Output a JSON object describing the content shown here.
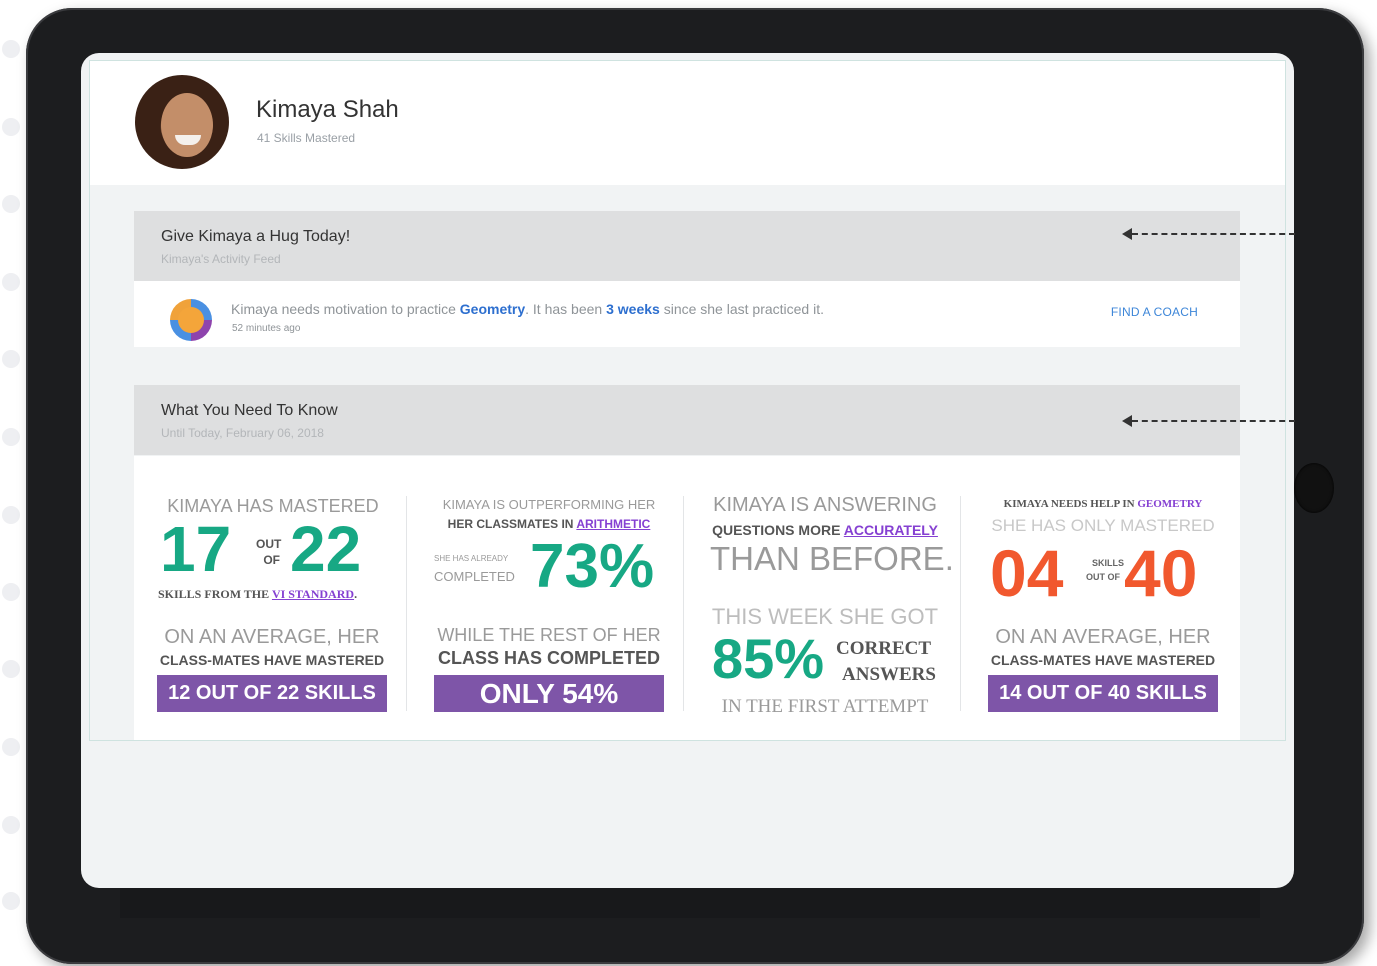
{
  "profile": {
    "name": "Kimaya Shah",
    "skills_mastered": "41 Skills Mastered"
  },
  "hug_section": {
    "title": "Give Kimaya a Hug Today!",
    "subtitle": "Kimaya's Activity Feed"
  },
  "feed": {
    "text_before": "Kimaya needs motivation to practice ",
    "subject": "Geometry",
    "text_middle": ". It has been ",
    "duration": "3 weeks",
    "text_after": " since she last practiced it.",
    "time": "52 minutes ago",
    "action": "FIND A COACH"
  },
  "know_section": {
    "title": "What You Need To Know",
    "subtitle": "Until Today, February 06, 2018"
  },
  "stat1": {
    "heading": "KIMAYA HAS MASTERED",
    "value": "17",
    "out_of_1": "OUT",
    "out_of_2": "OF",
    "total": "22",
    "caption": "SKILLS FROM THE",
    "link": "VI STANDARD",
    "caption_end": ".",
    "avg1": "ON AN AVERAGE, HER",
    "avg2": "CLASS-MATES HAVE MASTERED",
    "bar": "12 OUT OF 22 SKILLS"
  },
  "stat2": {
    "heading1": "KIMAYA IS OUTPERFORMING HER",
    "heading2": "HER CLASSMATES IN",
    "link": "ARITHMETIC",
    "small1": "SHE HAS ALREADY",
    "small2": "COMPLETED",
    "value": "73%",
    "rest1": "WHILE THE REST OF HER",
    "rest2": "CLASS HAS COMPLETED",
    "bar": "ONLY 54%"
  },
  "stat3": {
    "line1": "KIMAYA IS ANSWERING",
    "line2": "QUESTIONS MORE",
    "link": "ACCURATELY",
    "line3": "THAN BEFORE.",
    "line4": "THIS WEEK SHE GOT",
    "value": "85%",
    "correct": "CORRECT",
    "answers": "ANSWERS",
    "line5": "IN THE FIRST ATTEMPT"
  },
  "stat4": {
    "heading": "KIMAYA NEEDS HELP IN",
    "subject": "GEOMETRY",
    "sub": "SHE HAS ONLY MASTERED",
    "value": "04",
    "mid1": "SKILLS",
    "mid2": "OUT OF",
    "total": "40",
    "avg1": "ON AN AVERAGE, HER",
    "avg2": "CLASS-MATES HAVE MASTERED",
    "bar": "14 OUT OF 40 SKILLS"
  },
  "colors": {
    "green": "#17a884",
    "red": "#f1582e",
    "purple_bar": "#7e55a8",
    "link_purple": "#8540d2",
    "link_blue": "#2d6fcf"
  },
  "icons": [
    "arrow-left-icon",
    "hand-icon"
  ]
}
